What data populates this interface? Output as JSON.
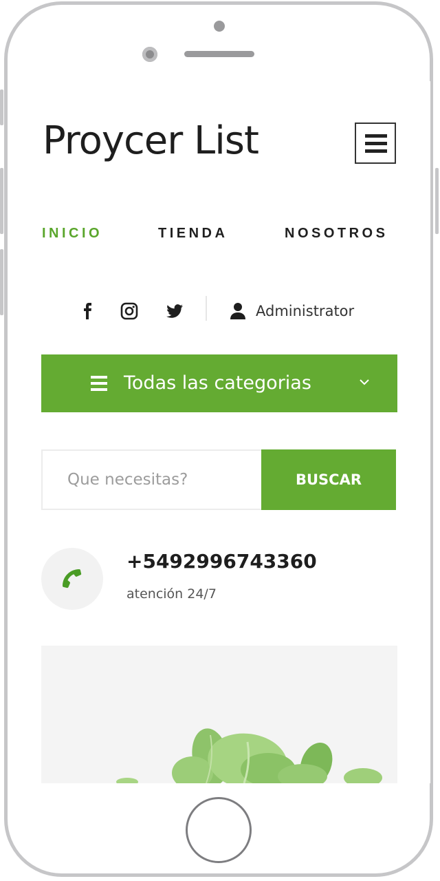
{
  "header": {
    "logo_text": "Proycer List",
    "menu_icon": "hamburger-menu-icon"
  },
  "nav": {
    "items": [
      {
        "label": "INICIO",
        "active": true
      },
      {
        "label": "TIENDA",
        "active": false
      },
      {
        "label": "NOSOTROS",
        "active": false
      }
    ]
  },
  "social": {
    "icons": [
      "facebook-icon",
      "instagram-icon",
      "twitter-icon"
    ],
    "user_label": "Administrator"
  },
  "categories": {
    "label": "Todas las categorias"
  },
  "search": {
    "placeholder": "Que necesitas?",
    "button_label": "BUSCAR"
  },
  "contact": {
    "phone": "+5492996743360",
    "subtitle": "atención 24/7"
  },
  "colors": {
    "accent": "#64ab32",
    "text": "#1e1e1e"
  }
}
